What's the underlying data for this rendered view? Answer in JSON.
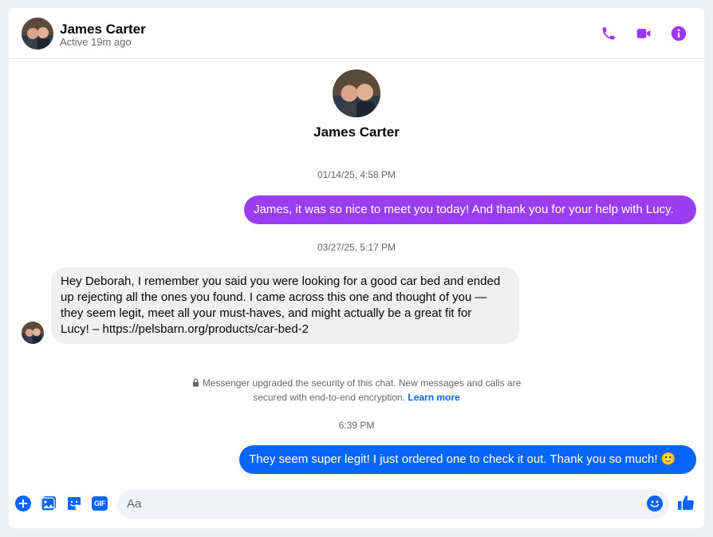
{
  "header": {
    "name": "James Carter",
    "status": "Active 19m ago",
    "icons": [
      "phone-icon",
      "video-camera-icon",
      "info-icon"
    ]
  },
  "profile": {
    "name": "James Carter"
  },
  "messages": [
    {
      "timestamp": "01/14/25, 4:58 PM"
    },
    {
      "text": "James, it was so nice to meet you today! And thank you for your help with Lucy."
    },
    {
      "timestamp": "03/27/25, 5:17 PM"
    },
    {
      "lines": [
        "Hey Deborah, I remember you said you were looking for a good car bed and ended",
        "up rejecting all the ones you found. I came across this one and thought of you —",
        "they seem legit, meet all your must-haves, and might actually be a great fit for",
        "Lucy! – https://pelsbarn.org/products/car-bed-2"
      ]
    },
    {
      "timestamp": "6:39 PM"
    },
    {
      "text": "They seem super legit! I just ordered one to check it out. Thank you so much! 🙂"
    }
  ],
  "security_notice": {
    "line1": "Messenger upgraded the security of this chat. New messages and calls are",
    "line2": "secured with end-to-end encryption.",
    "link": "Learn more"
  },
  "composer": {
    "placeholder": "Aa",
    "icons": [
      "plus-icon",
      "photo-icon",
      "sticker-icon",
      "gif-icon",
      "emoji-icon",
      "thumbs-up-icon"
    ],
    "gif_label": "GIF"
  },
  "colors": {
    "accent": "#0866ff",
    "header_icons": "#a033ff",
    "outgoing_first": "#9b3df0"
  }
}
